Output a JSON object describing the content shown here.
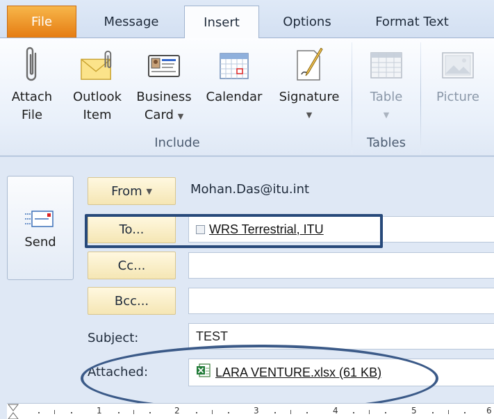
{
  "tabs": [
    {
      "label": "File"
    },
    {
      "label": "Message"
    },
    {
      "label": "Insert"
    },
    {
      "label": "Options"
    },
    {
      "label": "Format Text"
    }
  ],
  "ribbon": {
    "include": {
      "label": "Include",
      "buttons": [
        {
          "line1": "Attach",
          "line2": "File",
          "icon": "paperclip-icon"
        },
        {
          "line1": "Outlook",
          "line2": "Item",
          "icon": "envelope-clip-icon"
        },
        {
          "line1": "Business",
          "line2": "Card",
          "icon": "business-card-icon"
        },
        {
          "line1": "Calendar",
          "line2": "",
          "icon": "calendar-icon"
        },
        {
          "line1": "Signature",
          "line2": "",
          "icon": "signature-icon"
        }
      ]
    },
    "tables": {
      "label": "Tables",
      "buttons": [
        {
          "line1": "Table",
          "icon": "table-icon"
        }
      ]
    },
    "illustrations": {
      "buttons": [
        {
          "line1": "Picture",
          "icon": "picture-icon"
        }
      ]
    }
  },
  "compose": {
    "send_label": "Send",
    "from_label": "From",
    "from_address": "Mohan.Das@itu.int",
    "to_label": "To...",
    "to_recipient": "WRS Terrestrial, ITU",
    "cc_label": "Cc...",
    "cc_value": "",
    "bcc_label": "Bcc...",
    "bcc_value": "",
    "subject_label": "Subject:",
    "subject_value": "TEST",
    "attached_label": "Attached:",
    "attachment": "LARA VENTURE.xlsx (61 KB)"
  },
  "ruler": {
    "numbers": [
      "1",
      "2",
      "3",
      "4",
      "5",
      "6"
    ]
  },
  "colors": {
    "file_tab": "#e57c12",
    "annotation": "#27497a"
  }
}
